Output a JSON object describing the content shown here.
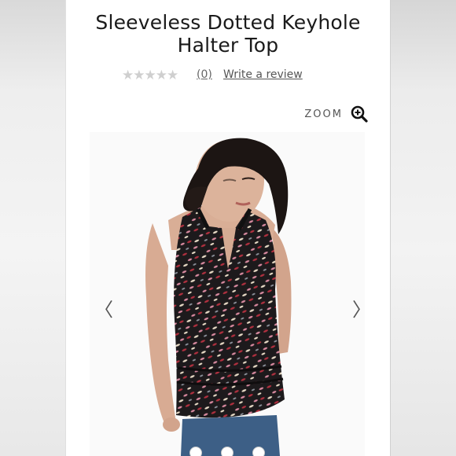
{
  "product": {
    "title": "Sleeveless Dotted Keyhole\nHalter Top",
    "rating_stars": "★★★★★",
    "review_count": "(0)",
    "write_review": "Write a review"
  },
  "gallery": {
    "zoom_label": "ZOOM",
    "prev_arrow": "〈",
    "next_arrow": "〉",
    "image_alt": "Model wearing sleeveless dotted keyhole halter top",
    "dot_count": 3
  },
  "colors": {
    "text_dark": "#1a1a1a",
    "star_empty": "#cfcfcf",
    "top_print_base": "#1d1a1c",
    "print_red": "#b2303f",
    "print_pink": "#d98aa0",
    "print_cream": "#e9dcc7",
    "jeans": "#3d5f86"
  }
}
